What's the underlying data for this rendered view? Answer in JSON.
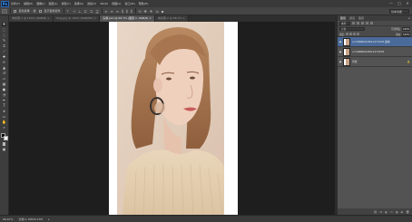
{
  "app": {
    "logo": "Ps"
  },
  "menu": [
    "文件(F)",
    "编辑(E)",
    "图像(I)",
    "图层(L)",
    "类型(Y)",
    "选择(S)",
    "滤镜(T)",
    "3D(D)",
    "视图(V)",
    "窗口(W)",
    "帮助(H)"
  ],
  "window_controls": {
    "minimize": "—",
    "maximize": "□",
    "close": "✕"
  },
  "options_bar": {
    "tool_label": "自动选择:",
    "target_value": "组",
    "transform_label": "显示变换控件",
    "workspace": "基本功能"
  },
  "tabs": [
    {
      "label": "未标题-1 @ 100% (RGB/8) ×",
      "active": false
    },
    {
      "label": "timg.jpg @ 100% (RGB/8#) ×",
      "active": false
    },
    {
      "label": "头像.psd @ 66.7% (图层 1, RGB/8) ×",
      "active": true
    },
    {
      "label": "未标题-2 @ 66.7% ×",
      "active": false
    }
  ],
  "tools": [
    "move",
    "marquee",
    "lasso",
    "quick-select",
    "crop",
    "eyedropper",
    "healing",
    "brush",
    "stamp",
    "history-brush",
    "eraser",
    "gradient",
    "blur",
    "dodge",
    "pen",
    "type",
    "path-select",
    "shape",
    "hand",
    "zoom"
  ],
  "status": {
    "zoom": "66.67%",
    "doc": "文档:1.76M/5.27M",
    "arrow": "▸"
  },
  "layers_panel": {
    "tabs": [
      "图层",
      "通道",
      "路径"
    ],
    "filter_label": "类型",
    "blend_mode": "正常",
    "opacity_label": "不透明度:",
    "opacity_value": "100%",
    "lock_label": "锁定:",
    "fill_label": "填充:",
    "fill_value": "100%",
    "layers": [
      {
        "name": "u=3288621059,2173476 副本",
        "selected": true
      },
      {
        "name": "u=3288621059,2173476",
        "selected": false
      },
      {
        "name": "背景",
        "selected": false,
        "lock": "🔒"
      }
    ],
    "footer_icons": [
      "⛓",
      "fx",
      "◐",
      "▭",
      "▤",
      "⊞",
      "🗑"
    ]
  },
  "colors": {
    "accent": "#4a6a9a",
    "background": "#262626",
    "panel": "#535353"
  }
}
